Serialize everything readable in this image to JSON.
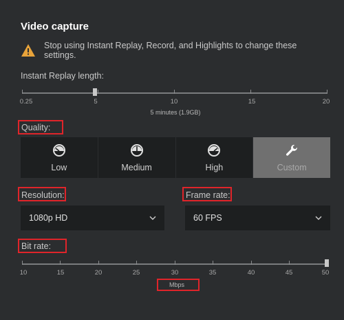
{
  "section_title": "Video capture",
  "warning_text": "Stop using Instant Replay, Record, and Highlights to change these settings.",
  "replay": {
    "label": "Instant Replay length:",
    "ticks": [
      "0.25",
      "5",
      "10",
      "15",
      "20"
    ],
    "value_minutes": 5,
    "value_text": "5 minutes (1.9GB)"
  },
  "quality": {
    "label": "Quality:",
    "options": [
      {
        "label": "Low",
        "icon": "gauge-low-icon"
      },
      {
        "label": "Medium",
        "icon": "gauge-medium-icon"
      },
      {
        "label": "High",
        "icon": "gauge-high-icon"
      },
      {
        "label": "Custom",
        "icon": "wrench-icon"
      }
    ],
    "selected": "Custom"
  },
  "resolution": {
    "label": "Resolution:",
    "value": "1080p HD"
  },
  "frame_rate": {
    "label": "Frame rate:",
    "value": "60 FPS"
  },
  "bitrate": {
    "label": "Bit rate:",
    "ticks": [
      "10",
      "15",
      "20",
      "25",
      "30",
      "35",
      "40",
      "45",
      "50"
    ],
    "value_mbps": 50,
    "unit": "Mbps"
  },
  "colors": {
    "background": "#2b2d2f",
    "panel": "#1d1f20",
    "selected": "#707070",
    "highlight_box": "#e0242a",
    "warning_icon": "#e8a33a"
  }
}
